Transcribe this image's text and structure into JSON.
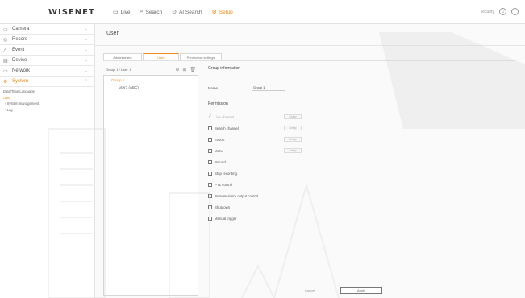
{
  "app": {
    "logo": "WISENET",
    "nav": [
      {
        "label": "Live",
        "icon": "monitor-icon",
        "active": false
      },
      {
        "label": "Search",
        "icon": "search-icon",
        "active": false
      },
      {
        "label": "AI Search",
        "icon": "ai-search-icon",
        "active": false
      },
      {
        "label": "Setup",
        "icon": "gear-icon",
        "active": true
      }
    ],
    "user_label": "security",
    "accent_color": "#f28b17"
  },
  "sidebar": {
    "items": [
      {
        "label": "Camera",
        "icon": "camera-icon"
      },
      {
        "label": "Record",
        "icon": "record-icon"
      },
      {
        "label": "Event",
        "icon": "bell-icon"
      },
      {
        "label": "Device",
        "icon": "device-icon"
      },
      {
        "label": "Network",
        "icon": "network-icon"
      },
      {
        "label": "System",
        "icon": "gear-icon",
        "active": true
      }
    ],
    "sub_items": [
      {
        "label": "Date/Time/Language",
        "active": false
      },
      {
        "label": "User",
        "active": true
      },
      {
        "label": "System management",
        "active": false
      },
      {
        "label": "Log",
        "active": false
      }
    ]
  },
  "page": {
    "title": "User",
    "tabs": [
      {
        "label": "Administrator",
        "active": false
      },
      {
        "label": "User",
        "active": true
      },
      {
        "label": "Permission settings",
        "active": false
      }
    ]
  },
  "tree": {
    "header": "Group: 1 / User: 1",
    "group": "Group 1",
    "user": "user1 (ABC)"
  },
  "group_info": {
    "title": "Group information",
    "name_label": "Name",
    "name_value": "Group 1",
    "permission_title": "Permission",
    "permissions": [
      {
        "label": "Live channel",
        "state": "checked-disabled",
        "has_setup": true
      },
      {
        "label": "Search channel",
        "state": "unchecked",
        "has_setup": true
      },
      {
        "label": "Export",
        "state": "unchecked",
        "has_setup": true
      },
      {
        "label": "Menu",
        "state": "unchecked",
        "has_setup": true
      },
      {
        "label": "Record",
        "state": "unchecked",
        "has_setup": false
      },
      {
        "label": "Stop recording",
        "state": "unchecked",
        "has_setup": false
      },
      {
        "label": "PTZ control",
        "state": "unchecked",
        "has_setup": false
      },
      {
        "label": "Remote alarm output control",
        "state": "unchecked",
        "has_setup": false
      },
      {
        "label": "Shutdown",
        "state": "unchecked",
        "has_setup": false
      },
      {
        "label": "Manual trigger",
        "state": "unchecked",
        "has_setup": false
      }
    ],
    "setup_label": "Setup"
  },
  "buttons": {
    "cancel": "Cancel",
    "apply": "Apply"
  }
}
